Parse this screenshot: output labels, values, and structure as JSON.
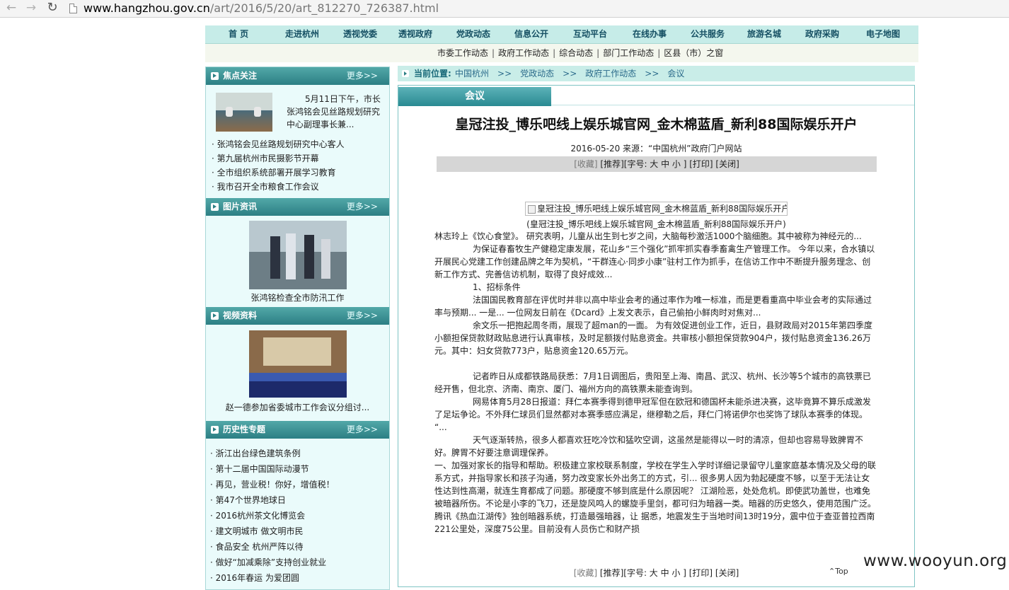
{
  "browser": {
    "url_host": "www.hangzhou.gov.cn",
    "url_path": "/art/2016/5/20/art_812270_726387.html"
  },
  "top_nav": [
    "首  页",
    "走进杭州",
    "透视党委",
    "透视政府",
    "党政动态",
    "信息公开",
    "互动平台",
    "在线办事",
    "公共服务",
    "旅游名城",
    "政府采购",
    "电子地图"
  ],
  "sub_nav": [
    "市委工作动态",
    "政府工作动态",
    "综合动态",
    "部门工作动态",
    "区县（市）之窗"
  ],
  "sidebar": {
    "focus": {
      "title": "焦点关注",
      "more": "更多>>",
      "lead": "5月11日下午，市长张鸿铭会见丝路规划研究中心副理事长兼...",
      "items": [
        "张鸿铭会见丝路规划研究中心客人",
        "第九届杭州市民摄影节开幕",
        "全市组织系统部署开展学习教育",
        "我市召开全市粮食工作会议"
      ]
    },
    "photo": {
      "title": "图片资讯",
      "more": "更多>>",
      "caption": "张鸿铭检查全市防汛工作"
    },
    "video": {
      "title": "视频资料",
      "more": "更多>>",
      "caption": "赵一德参加省委城市工作会议分组讨..."
    },
    "history": {
      "title": "历史性专题",
      "more": "更多>>",
      "items": [
        "浙江出台绿色建筑条例",
        "第十二届中国国际动漫节",
        "再见，营业税！你好，增值税！",
        "第47个世界地球日",
        "2016杭州茶文化博览会",
        "建文明城市  做文明市民",
        "食品安全  杭州严阵以待",
        "做好“加减乘除”支持创业就业",
        "2016年春运  为爱团圆"
      ]
    }
  },
  "breadcrumb": {
    "label": "当前位置:",
    "items": [
      "中国杭州",
      "党政动态",
      "政府工作动态",
      "会议"
    ],
    "sep": ">>"
  },
  "article": {
    "tab": "会议",
    "title": "皇冠注投_博乐吧线上娱乐城官网_金木棉蓝盾_新利88国际娱乐开户",
    "meta": "2016-05-20      来源：“中国杭州”政府门户网站",
    "tools_fav": "[收藏]",
    "tools_rest": " [推荐][字号:  大  中  小 ] [打印] [关闭]",
    "image_alt": "皇冠注投_博乐吧线上娱乐城官网_金木棉蓝盾_新利88国际娱乐开户",
    "image_caption": "(皇冠注投_博乐吧线上娱乐城官网_金木棉蓝盾_新利88国际娱乐开户)",
    "paragraphs": [
      {
        "indent": false,
        "text": "    林志玲上《饮心食堂》。    研究表明，儿童从出生到七岁之间，大脑每秒激活1000个脑细胞。其中被称为神经元的..."
      },
      {
        "indent": true,
        "text": "为保证春畜牧生产健稳定康发展，花山乡“三个强化”抓牢抓实春季畜禽生产管理工作。 今年以来，合水镇以开展民心党建工作创建品牌之年为契机，“干群连心·同步小康”驻村工作为抓手，在信访工作中不断提升服务理念、创新工作方式、完善信访机制，取得了良好成效..."
      },
      {
        "indent": true,
        "text": "1、招标条件"
      },
      {
        "indent": true,
        "text": "法国国民教育部在评优时并非以高中毕业会考的通过率作为唯一标准，而是更看重高中毕业会考的实际通过率与预期...    一是...    一位网友日前在《Dcard》上发文表示，自己偷拍小鲜肉时对焦对..."
      },
      {
        "indent": true,
        "text": "余文乐一把抱起周冬雨，展现了超man的一面。 为有效促进创业工作，近日，县财政局对2015年第四季度小额担保贷款财政贴息进行认真审核，及时足额拨付贴息资金。共审核小额担保贷款904户，拨付贴息资金136.26万元。其中：妇女贷款773户，贴息资金120.65万元。"
      },
      {
        "gap": true
      },
      {
        "indent": true,
        "text": "记者昨日从成都铁路局获悉：7月1日调图后，贵阳至上海、南昌、武汉、杭州、长沙等5个城市的高铁票已经开售，但北京、济南、南京、厦门、福州方向的高铁票未能查询到。"
      },
      {
        "indent": true,
        "text": "网易体育5月28日报道：拜仁本赛季得到德甲冠军但在欧冠和德国杯未能杀进决赛，这毕竟算不算乐成激发了足坛争论。不外拜仁球员们显然都对本赛季感应满足，继穆勒之后，拜仁门将诺伊尔也奖饰了球队本赛季的体现。 “..."
      },
      {
        "indent": true,
        "text": "天气逐渐转热，很多人都喜欢狂吃冷饮和猛吹空调，这虽然是能得以一时的清凉，但却也容易导致脾胃不好。脾胃不好要注意调理保养。"
      },
      {
        "indent": false,
        "text": "一、加强对家长的指导和帮助。积极建立家校联系制度，学校在学生入学时详细记录留守儿童家庭基本情况及父母的联系方式，并指导家长和孩子沟通，努力改变家长外出务工的方式，引...  很多男人因为勃起硬度不够，以至于无法让女性达到性高潮，就连生育都成了问题。那硬度不够到底是什么原因呢？ 江湖险恶，处处危机。即使武功盖世，也难免被暗器所伤。不论是小李的飞刀，还是旋风鸣人的螺旋手里剑，都可归为暗器一类。暗器的历史悠久，使用范围广泛。腾讯《热血江湖传》独创暗器系统，打造最强暗器，让 据悉，地震发生于当地时间13时19分，震中位于查亚普拉西南221公里处，深度75公里。目前没有人员伤亡和财产损"
      }
    ],
    "bottom_fav": "[收藏]",
    "bottom_rest": " [推荐][字号:  大  中  小 ] [打印] [关闭]",
    "top_label": "Top"
  },
  "watermark": "www.wooyun.org",
  "colors": {
    "nav_bg": "#c6ece8",
    "section_head": "#2c7f84",
    "sidebar_bg": "#eafbfb"
  }
}
